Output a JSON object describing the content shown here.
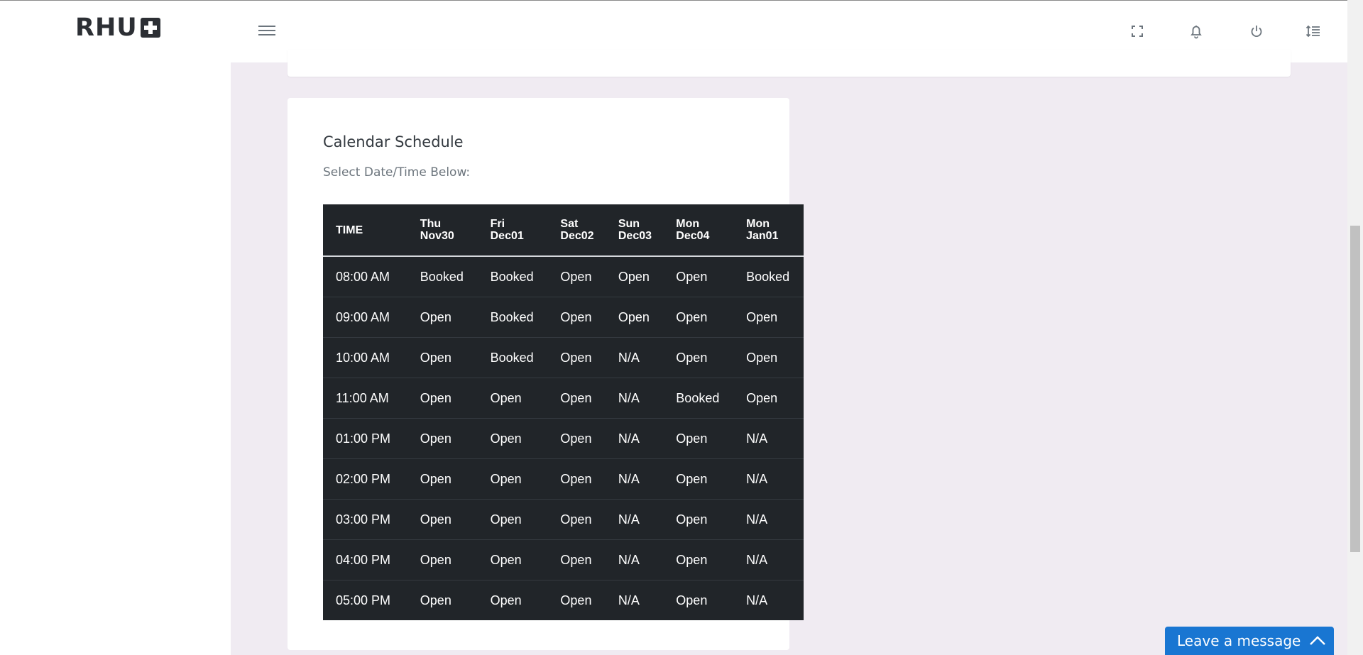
{
  "brand": {
    "name": "RHU"
  },
  "header_icons": [
    "menu-icon",
    "fullscreen-icon",
    "bell-icon",
    "power-icon",
    "line-height-icon"
  ],
  "card": {
    "title": "Calendar Schedule",
    "subtitle": "Select Date/Time Below:"
  },
  "schedule": {
    "time_header": "TIME",
    "days": [
      {
        "dow": "Thu",
        "date": "Nov30"
      },
      {
        "dow": "Fri",
        "date": "Dec01"
      },
      {
        "dow": "Sat",
        "date": "Dec02"
      },
      {
        "dow": "Sun",
        "date": "Dec03"
      },
      {
        "dow": "Mon",
        "date": "Dec04"
      },
      {
        "dow": "Mon",
        "date": "Jan01"
      }
    ],
    "rows": [
      {
        "time": "08:00 AM",
        "slots": [
          "Booked",
          "Booked",
          "Open",
          "Open",
          "Open",
          "Booked"
        ]
      },
      {
        "time": "09:00 AM",
        "slots": [
          "Open",
          "Booked",
          "Open",
          "Open",
          "Open",
          "Open"
        ]
      },
      {
        "time": "10:00 AM",
        "slots": [
          "Open",
          "Booked",
          "Open",
          "N/A",
          "Open",
          "Open"
        ]
      },
      {
        "time": "11:00 AM",
        "slots": [
          "Open",
          "Open",
          "Open",
          "N/A",
          "Booked",
          "Open"
        ]
      },
      {
        "time": "01:00 PM",
        "slots": [
          "Open",
          "Open",
          "Open",
          "N/A",
          "Open",
          "N/A"
        ]
      },
      {
        "time": "02:00 PM",
        "slots": [
          "Open",
          "Open",
          "Open",
          "N/A",
          "Open",
          "N/A"
        ]
      },
      {
        "time": "03:00 PM",
        "slots": [
          "Open",
          "Open",
          "Open",
          "N/A",
          "Open",
          "N/A"
        ]
      },
      {
        "time": "04:00 PM",
        "slots": [
          "Open",
          "Open",
          "Open",
          "N/A",
          "Open",
          "N/A"
        ]
      },
      {
        "time": "05:00 PM",
        "slots": [
          "Open",
          "Open",
          "Open",
          "N/A",
          "Open",
          "N/A"
        ]
      }
    ]
  },
  "chat": {
    "label": "Leave a message",
    "icon": "chevron-up-icon"
  },
  "colors": {
    "table_bg": "#212529",
    "chat_bg": "#1976d2",
    "page_bg": "#f0ebf2"
  }
}
